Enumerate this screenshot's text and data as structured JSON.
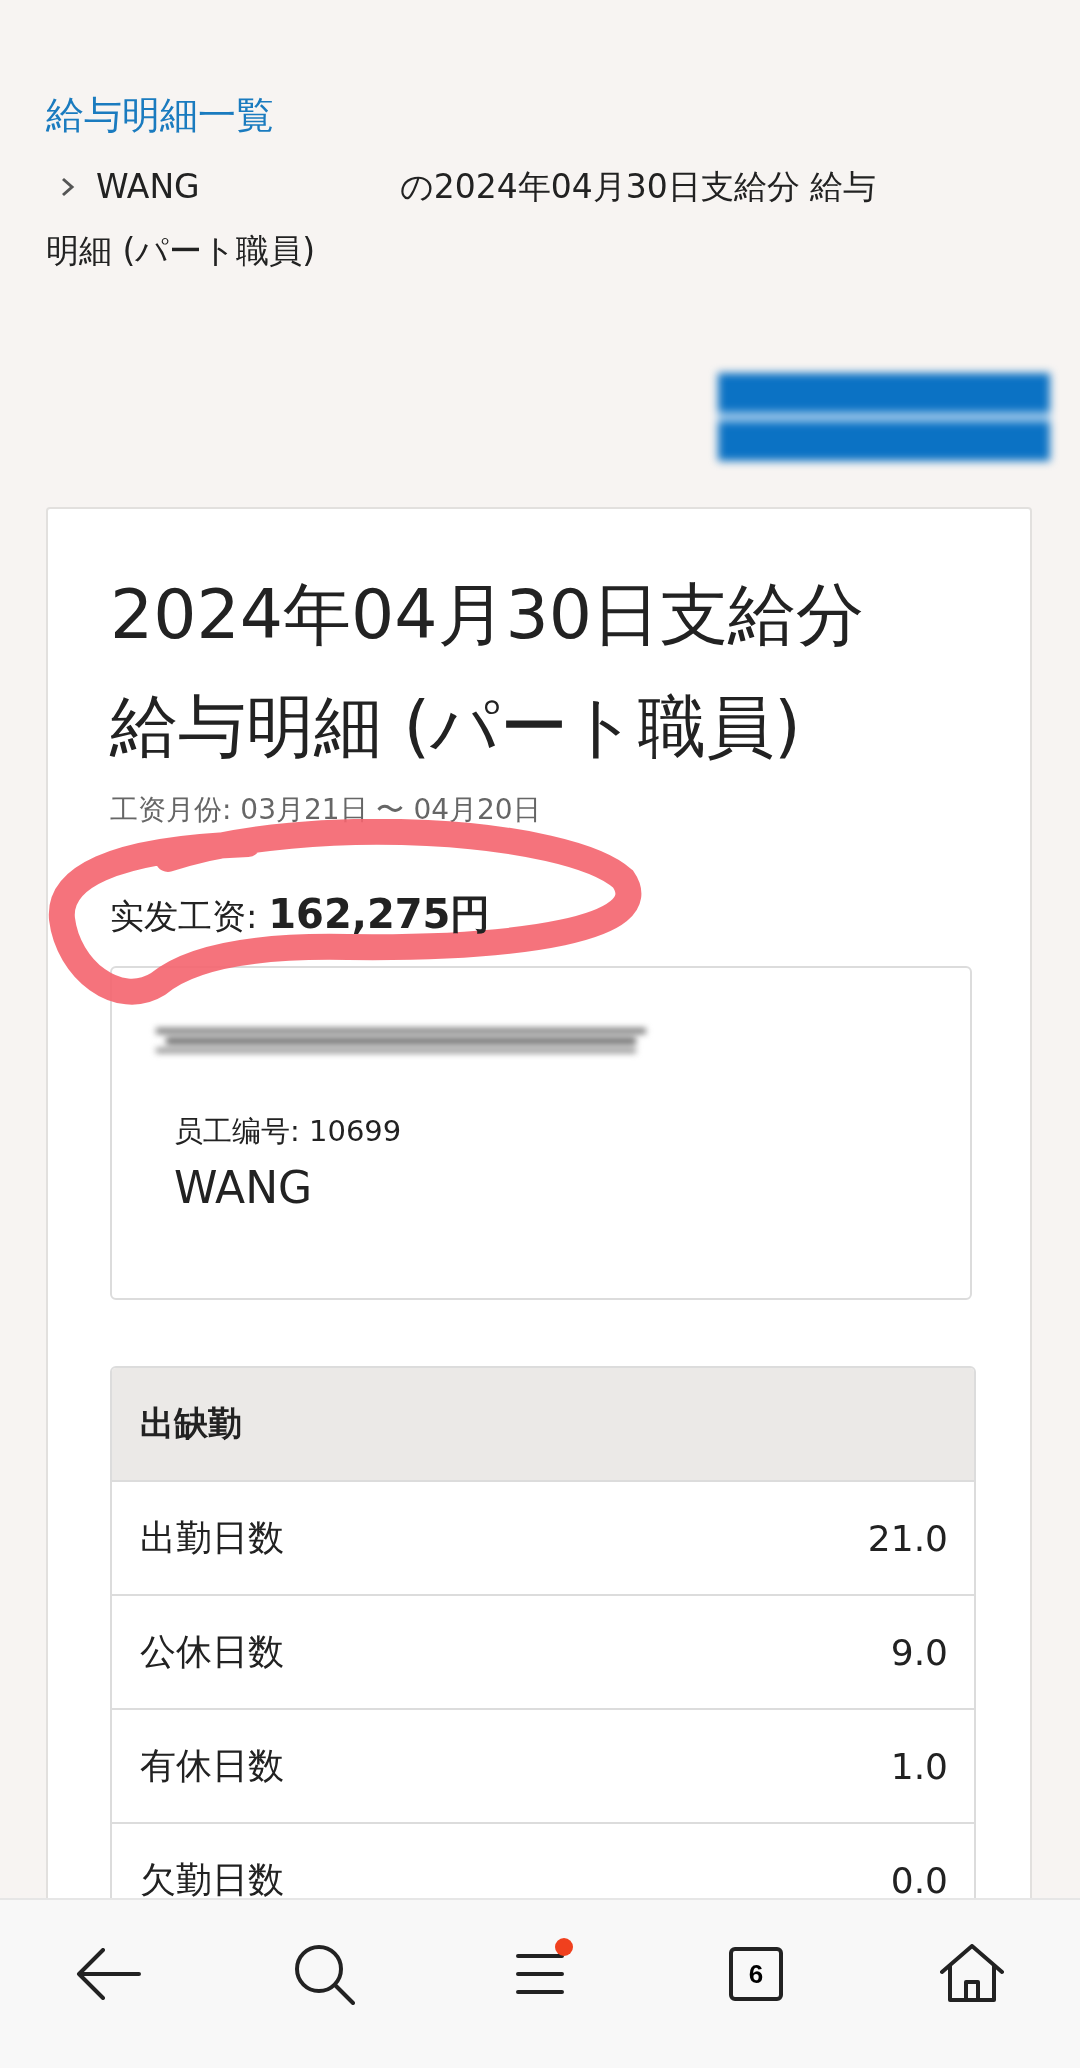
{
  "breadcrumb": {
    "link": "給与明細一覧",
    "name": "WANG",
    "current": [
      "の2024年04月30日支給分 給与",
      "明細 (パート職員)"
    ]
  },
  "payslip": {
    "title_line_1": "2024年04月30日支給分",
    "title_line_2": "給与明細 (パート職員)",
    "period": "工资月份: 03月21日 〜 04月20日",
    "net_pay_label": "实发工资: ",
    "net_pay": "162,275円",
    "employee": {
      "number": "员工编号: 10699",
      "name": "WANG"
    },
    "attendance": {
      "heading": "出缺勤",
      "rows": [
        {
          "label": "出勤日数",
          "value": "21.0"
        },
        {
          "label": "公休日数",
          "value": "9.0"
        },
        {
          "label": "有休日数",
          "value": "1.0"
        },
        {
          "label": "欠勤日数",
          "value": "0.0"
        }
      ]
    }
  },
  "bottom_nav": [
    {
      "kind": "back",
      "badge": false
    },
    {
      "kind": "search",
      "badge": false
    },
    {
      "kind": "menu",
      "badge": true
    },
    {
      "kind": "tabs",
      "count": "6",
      "badge": false
    },
    {
      "kind": "home",
      "badge": false
    }
  ]
}
